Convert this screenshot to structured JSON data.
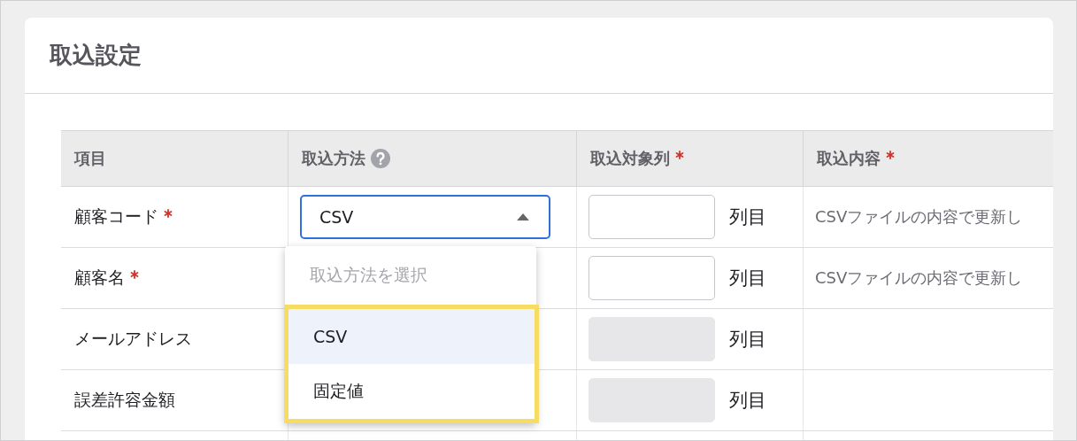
{
  "page": {
    "title": "取込設定"
  },
  "table": {
    "columns": [
      {
        "label": "項目",
        "required": false,
        "help": false
      },
      {
        "label": "取込方法",
        "required": false,
        "help": true
      },
      {
        "label": "取込対象列",
        "required": true,
        "help": false
      },
      {
        "label": "取込内容",
        "required": true,
        "help": false
      }
    ],
    "rows": [
      {
        "label": "顧客コード",
        "required": true,
        "method": "CSV",
        "column_disabled": false,
        "column_unit": "列目",
        "content": "CSVファイルの内容で更新し"
      },
      {
        "label": "顧客名",
        "required": true,
        "column_disabled": false,
        "column_unit": "列目",
        "content": "CSVファイルの内容で更新し"
      },
      {
        "label": "メールアドレス",
        "required": false,
        "column_disabled": true,
        "column_unit": "列目"
      },
      {
        "label": "誤差許容金額",
        "required": false,
        "column_disabled": true,
        "column_unit": "列目"
      }
    ]
  },
  "dropdown": {
    "expanded": true,
    "prompt": "取込方法を選択",
    "options_highlighted": true,
    "options": [
      {
        "label": "CSV",
        "selected": true
      },
      {
        "label": "固定値",
        "selected": false
      }
    ]
  }
}
